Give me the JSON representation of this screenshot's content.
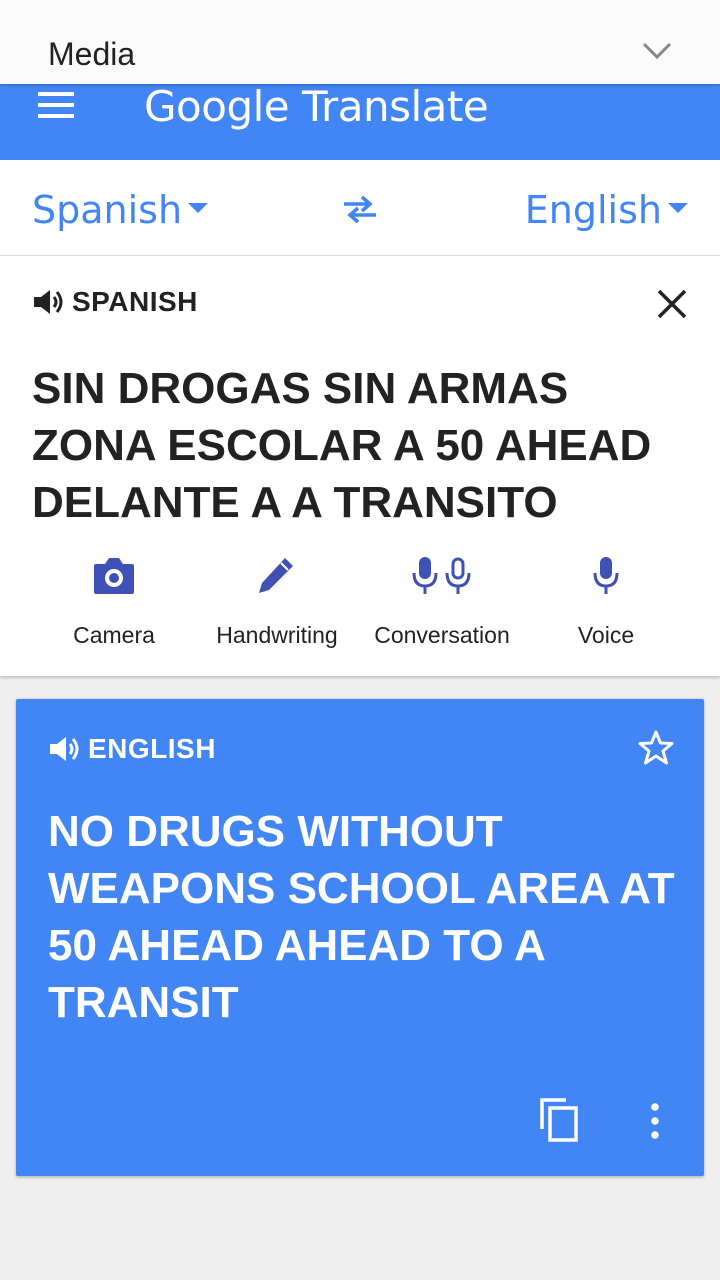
{
  "notification": {
    "title": "Media"
  },
  "app_bar": {
    "title": "Google Translate"
  },
  "language_bar": {
    "source": "Spanish",
    "target": "English"
  },
  "input": {
    "label": "SPANISH",
    "text": "SIN DROGAS SIN ARMAS ZONA ESCOLAR A 50 AHEAD DELANTE A A TRANSITO"
  },
  "tools": [
    {
      "label": "Camera",
      "icon": "camera-icon"
    },
    {
      "label": "Handwriting",
      "icon": "pen-icon"
    },
    {
      "label": "Conversation",
      "icon": "dual-mic-icon"
    },
    {
      "label": "Voice",
      "icon": "mic-icon"
    }
  ],
  "output": {
    "label": "ENGLISH",
    "text": "NO DRUGS WITHOUT WEAPONS SCHOOL AREA AT 50 AHEAD AHEAD TO A TRANSIT"
  },
  "colors": {
    "accent": "#4285f4",
    "tool_icon": "#3f51b5"
  }
}
